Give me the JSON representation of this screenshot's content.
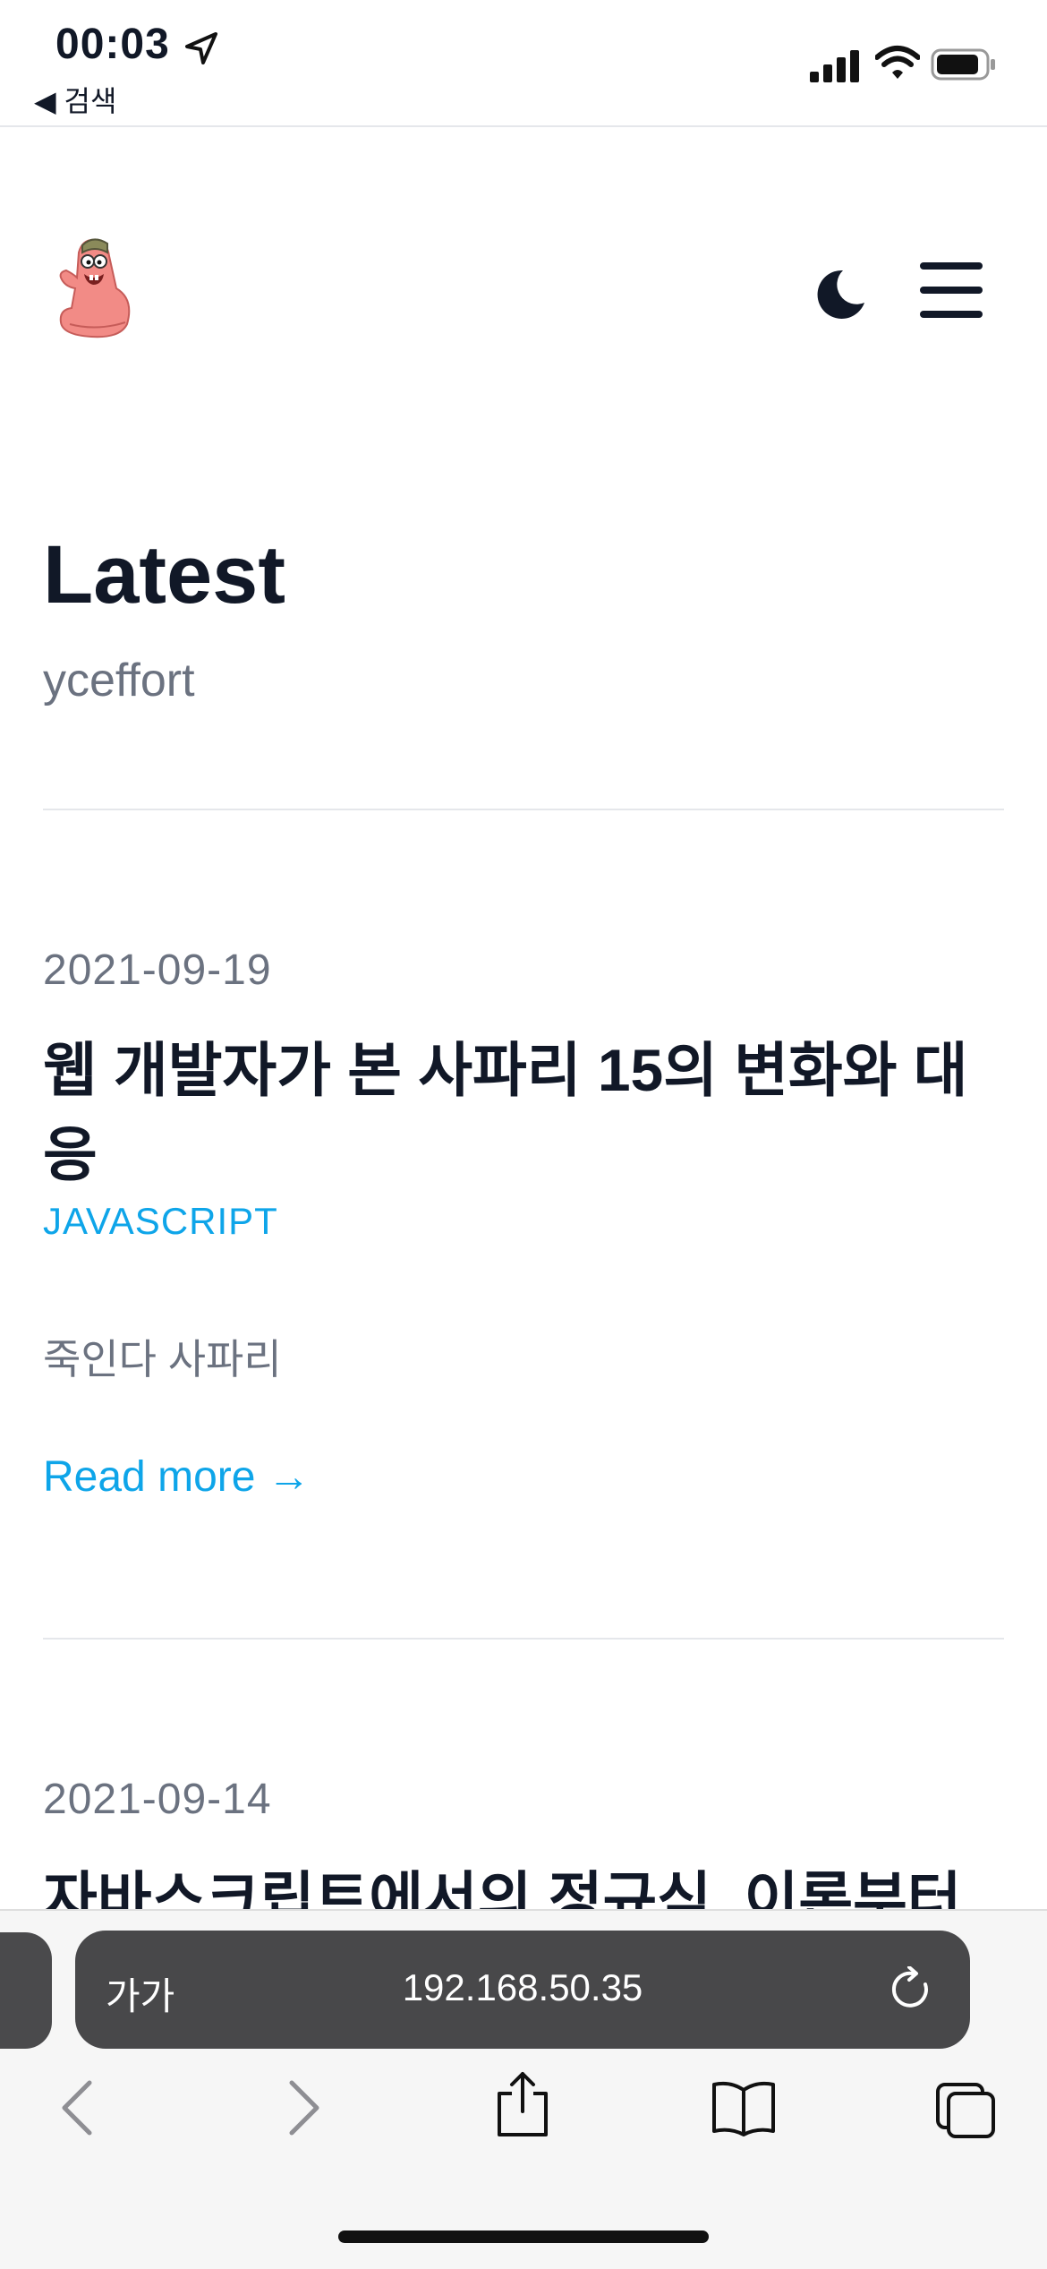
{
  "status_bar": {
    "time": "00:03",
    "back_app": "◀ 검색"
  },
  "header": {
    "avatar_alt": "patrick-star-avatar"
  },
  "hero": {
    "title": "Latest",
    "subtitle": "yceffort"
  },
  "posts": [
    {
      "date": "2021-09-19",
      "title": "웹 개발자가 본 사파리 15의 변화와 대응",
      "tag": "JAVASCRIPT",
      "summary": "죽인다 사파리",
      "read_more": "Read more →"
    },
    {
      "date": "2021-09-14",
      "title": "자바스크립트에서의 정규식, 이론부터"
    }
  ],
  "browser": {
    "text_size_label": "가가",
    "url": "192.168.50.35"
  },
  "colors": {
    "accent": "#0ea5e9",
    "heading": "#111827",
    "muted": "#6b7280",
    "url_bar": "#48484a"
  }
}
